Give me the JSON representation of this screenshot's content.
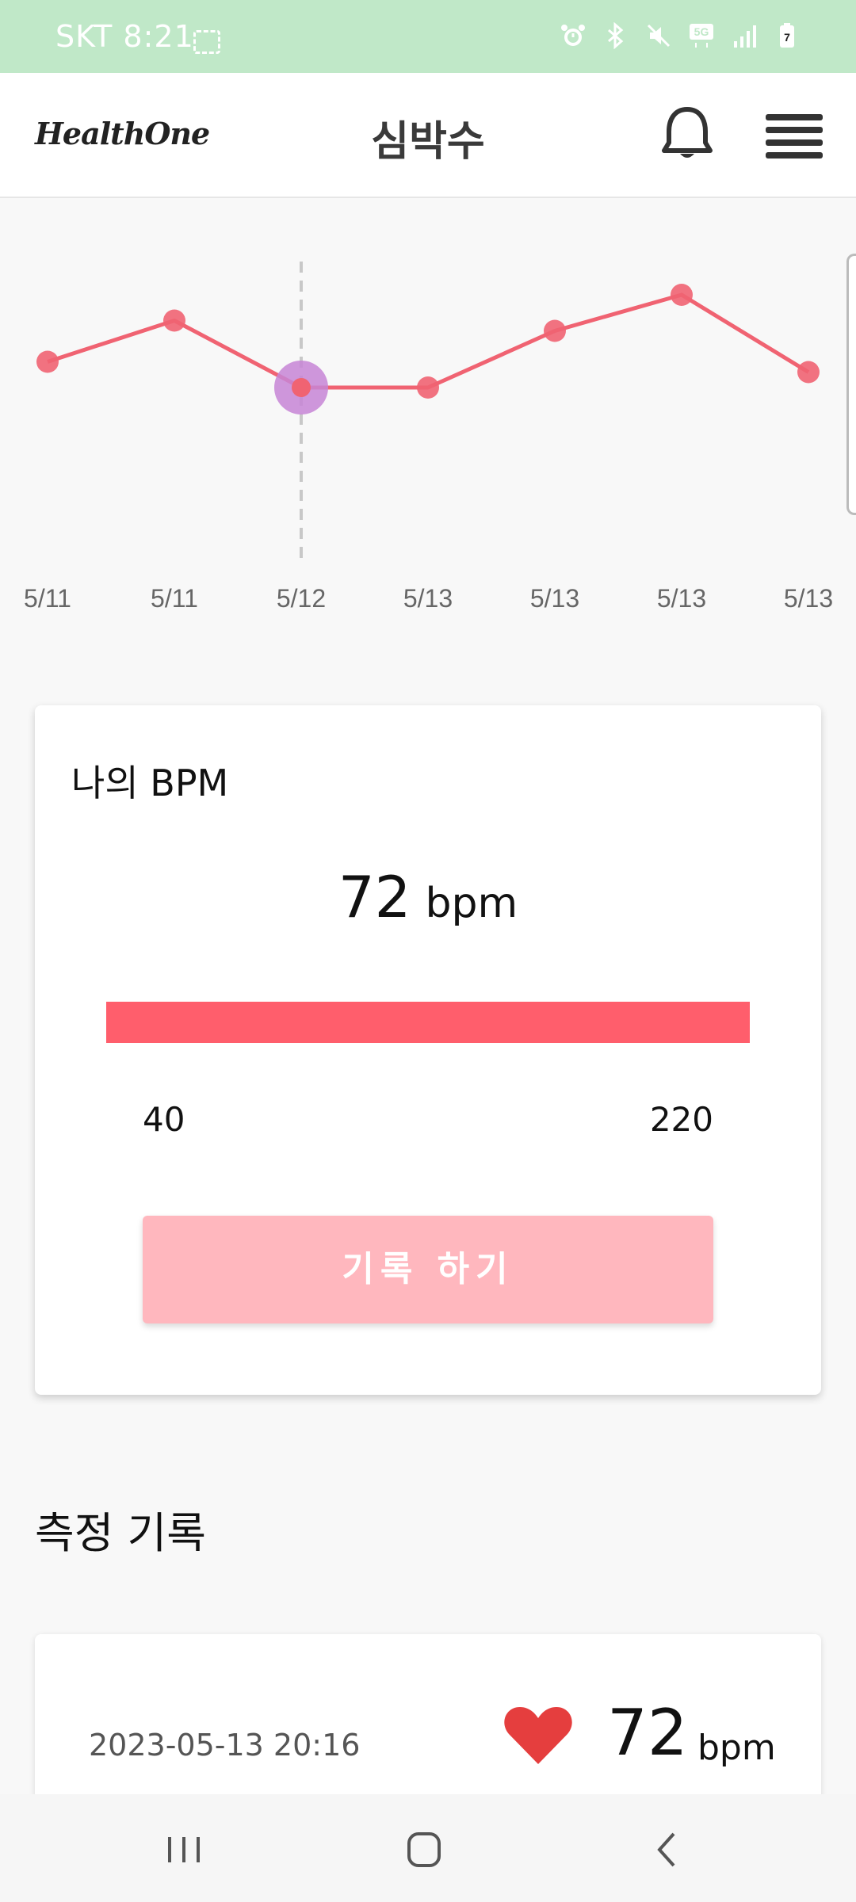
{
  "status_bar": {
    "carrier": "SKT",
    "time": "8:21",
    "icons": [
      "alarm-icon",
      "bluetooth-icon",
      "mute-icon",
      "5g-icon",
      "signal-icon",
      "battery-icon"
    ],
    "battery_level": "7"
  },
  "header": {
    "logo": "HealthOne",
    "title": "심박수",
    "icons": [
      "bell-icon",
      "menu-icon"
    ]
  },
  "chart_data": {
    "type": "line",
    "categories": [
      "5/11",
      "5/11",
      "5/12",
      "5/13",
      "5/13",
      "5/13",
      "5/13"
    ],
    "series": [
      {
        "values": [
          74,
          82,
          69,
          69,
          80,
          87,
          72
        ],
        "color": "#f06372"
      }
    ],
    "ylim": [
      55,
      95
    ],
    "selected_index": 2,
    "selected_color": "#c785d6",
    "grid": false
  },
  "bpm_card": {
    "title": "나의 BPM",
    "value": "72",
    "unit": "bpm",
    "range_min": "40",
    "range_max": "220",
    "bar_fill_fraction": 1.0,
    "bar_color": "#ff5e6c",
    "button_label": "기록 하기",
    "button_color": "#ffb7be"
  },
  "history": {
    "title": "측정 기록",
    "items": [
      {
        "date": "2023-05-13 20:16",
        "value": "72",
        "unit": "bpm",
        "icon": "heart-icon"
      }
    ]
  },
  "nav": {
    "buttons": [
      "recent-apps-icon",
      "home-icon",
      "back-icon"
    ]
  }
}
